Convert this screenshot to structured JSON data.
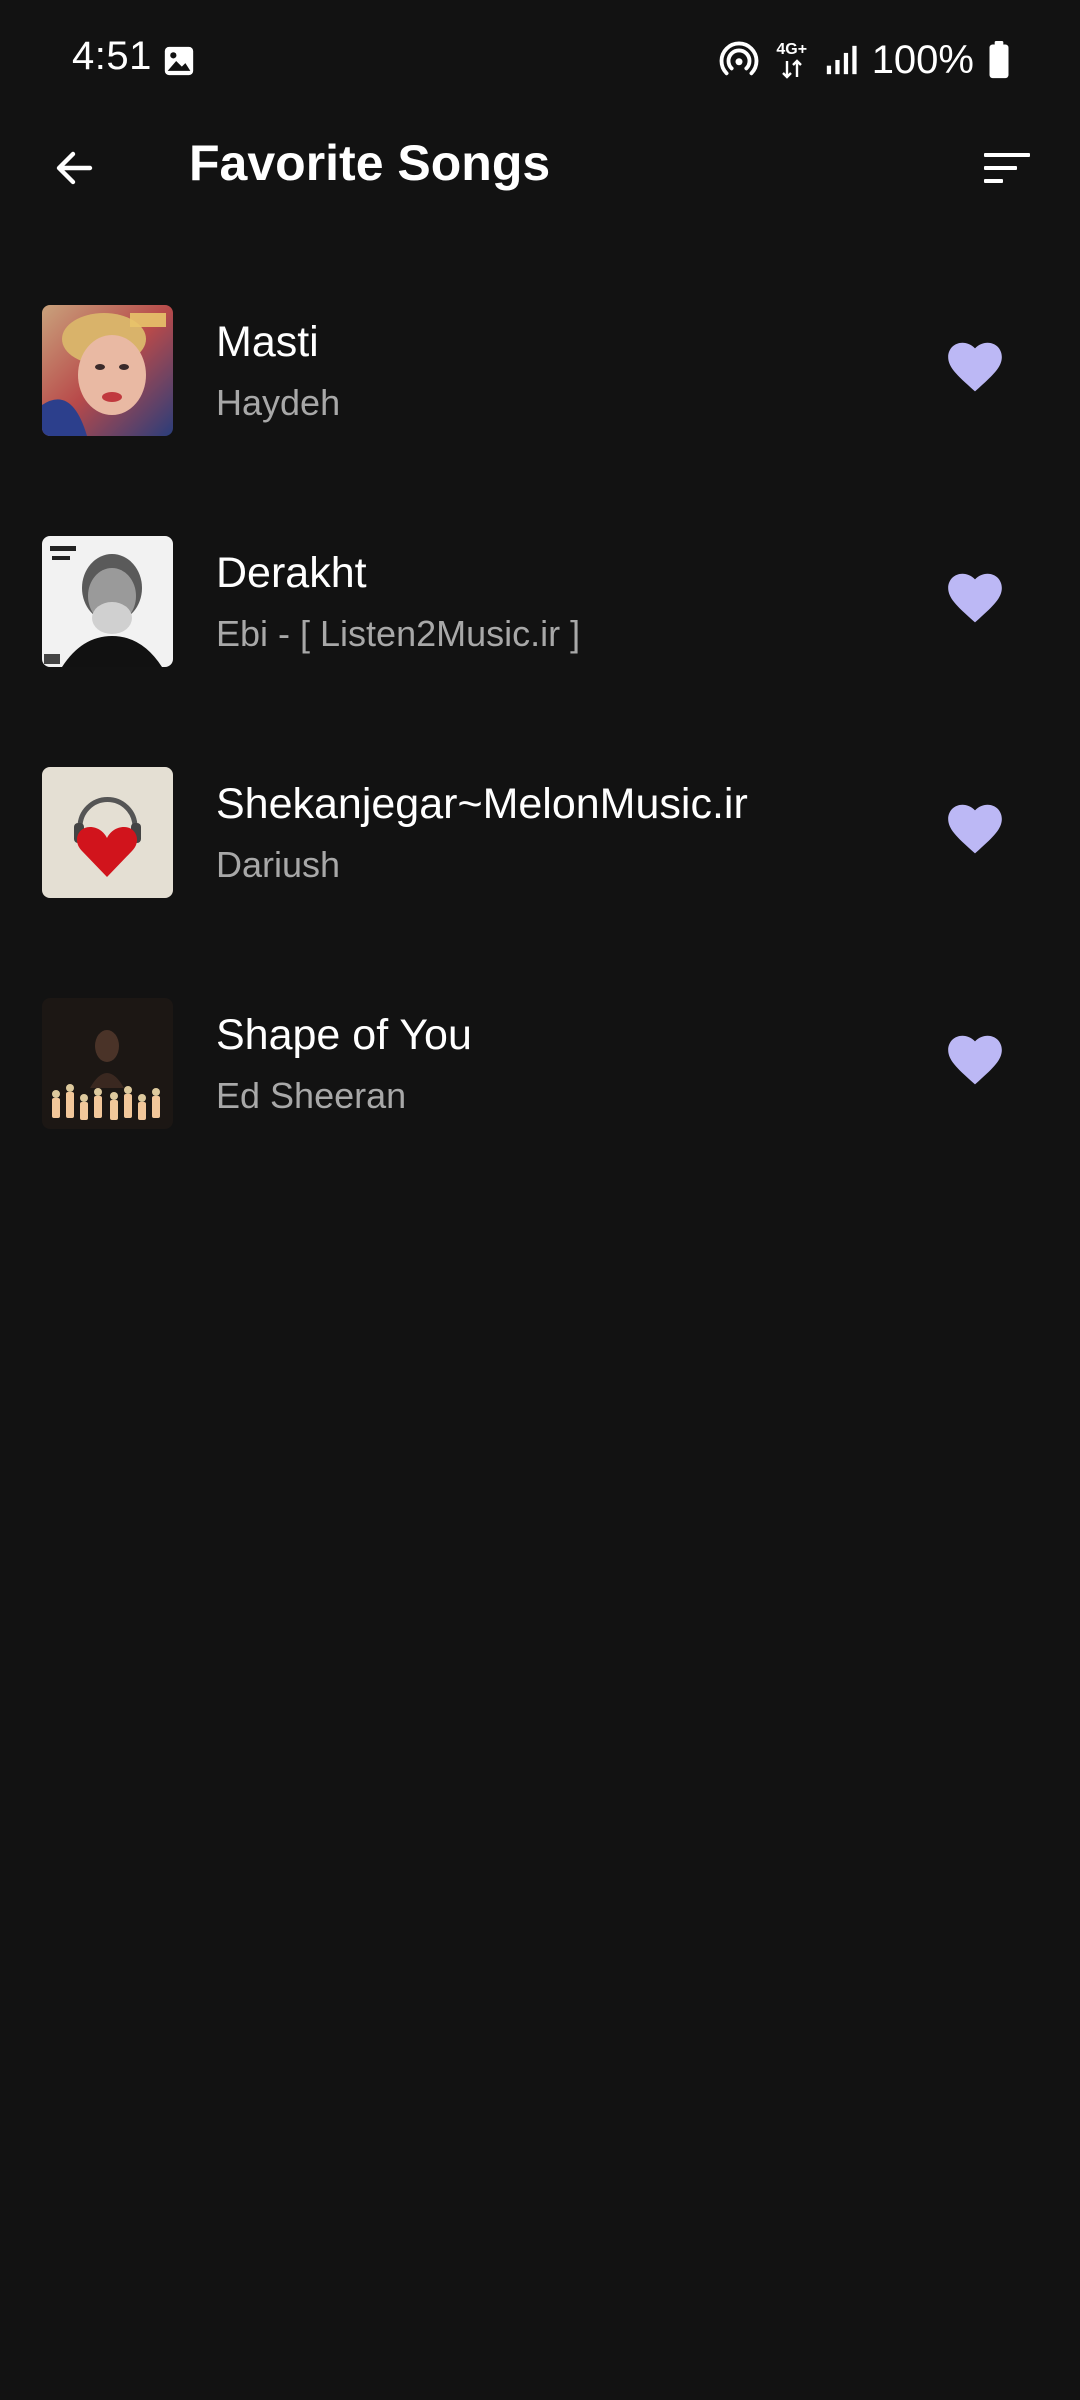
{
  "status_bar": {
    "time": "4:51",
    "battery": "100%",
    "network": "4G+",
    "icons": [
      "gallery-icon",
      "hotspot-icon",
      "data-arrows-icon",
      "signal-icon",
      "battery-icon"
    ]
  },
  "app_bar": {
    "title": "Favorite Songs",
    "back_icon": "arrow-back-icon",
    "sort_icon": "sort-icon"
  },
  "colors": {
    "background": "#121212",
    "heart": "#bcb8f5",
    "title_text": "#ffffff",
    "artist_text": "#a8a8a8"
  },
  "songs": [
    {
      "title": "Masti",
      "artist": "Haydeh",
      "favorited": true
    },
    {
      "title": "Derakht",
      "artist": "Ebi - [ Listen2Music.ir ]",
      "favorited": true
    },
    {
      "title": "Shekanjegar~MelonMusic.ir",
      "artist": "Dariush",
      "favorited": true
    },
    {
      "title": "Shape of You",
      "artist": "Ed Sheeran",
      "favorited": true
    }
  ]
}
